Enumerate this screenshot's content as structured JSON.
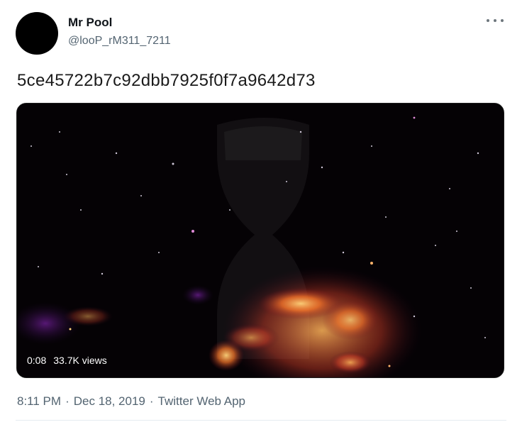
{
  "tweet": {
    "author_name": "Mr Pool",
    "author_handle": "@looP_rM311_7211",
    "text": "5ce45722b7c92dbb7925f0f7a9642d73",
    "video": {
      "duration": "0:08",
      "views": "33.7K views"
    },
    "time": "8:11 PM",
    "separator": "·",
    "date": "Dec 18, 2019",
    "client": "Twitter Web App"
  },
  "icons": {
    "more": "more-dots-icon"
  },
  "colors": {
    "text_primary": "#0f1419",
    "text_secondary": "#536471",
    "video_bg": "#050205"
  }
}
